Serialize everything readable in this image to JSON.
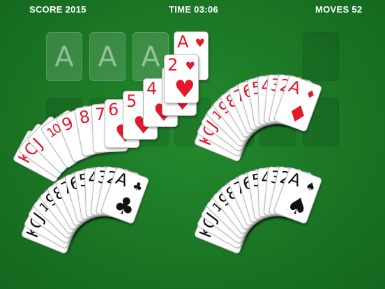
{
  "hud": {
    "score": "SCORE 2015",
    "time": "TIME 03:06",
    "moves": "MOVES 52"
  },
  "foundations": {
    "ghost_label": "A",
    "top_card": {
      "rank": "A",
      "suit": "♥",
      "color": "red"
    }
  },
  "top_fan": {
    "ranks": [
      "K",
      "Q",
      "J",
      "10",
      "9",
      "8",
      "7",
      "6",
      "5",
      "4",
      "3",
      "2"
    ],
    "suit": "♥",
    "color": "red"
  },
  "hands": [
    {
      "id": "diamonds",
      "suit": "♦",
      "color": "red",
      "ranks": [
        "K",
        "Q",
        "J",
        "10",
        "9",
        "8",
        "7",
        "6",
        "5",
        "4",
        "3",
        "2",
        "A"
      ]
    },
    {
      "id": "clubs",
      "suit": "♣",
      "color": "black",
      "ranks": [
        "K",
        "Q",
        "J",
        "10",
        "9",
        "8",
        "7",
        "6",
        "5",
        "4",
        "3",
        "2",
        "A"
      ]
    },
    {
      "id": "spades",
      "suit": "♠",
      "color": "black",
      "ranks": [
        "K",
        "Q",
        "J",
        "10",
        "9",
        "8",
        "7",
        "6",
        "5",
        "4",
        "3",
        "2",
        "A"
      ]
    }
  ],
  "colors": {
    "felt": "#1a7a26",
    "red_suit": "#e3192b",
    "black_suit": "#111111"
  }
}
